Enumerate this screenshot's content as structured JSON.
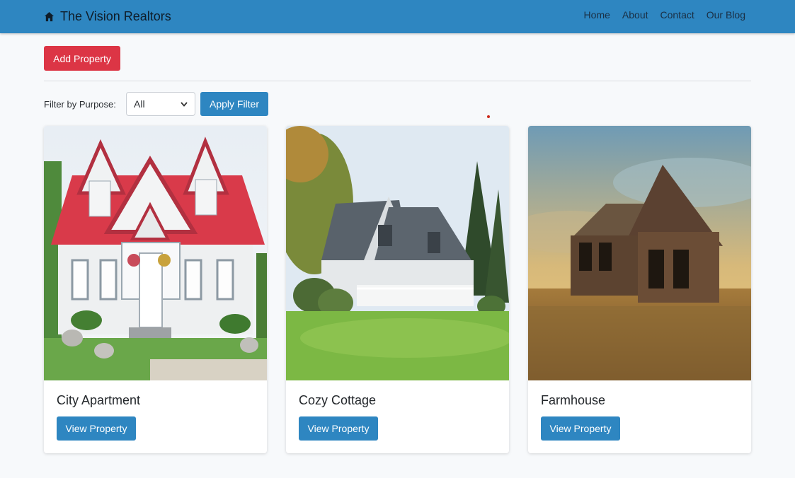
{
  "navbar": {
    "brand": "The Vision Realtors",
    "links": [
      "Home",
      "About",
      "Contact",
      "Our Blog"
    ],
    "color": "#2e86c1"
  },
  "actions": {
    "add_property": "Add Property"
  },
  "filter": {
    "label": "Filter by Purpose:",
    "selected": "All",
    "apply": "Apply Filter"
  },
  "properties": [
    {
      "title": "City Apartment",
      "button": "View Property"
    },
    {
      "title": "Cozy Cottage",
      "button": "View Property"
    },
    {
      "title": "Farmhouse",
      "button": "View Property"
    }
  ],
  "colors": {
    "primary": "#2e86c1",
    "danger": "#dc3545",
    "background": "#f7f9fb"
  }
}
